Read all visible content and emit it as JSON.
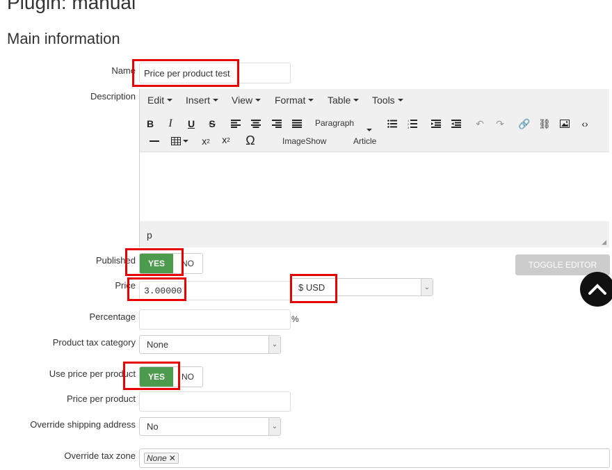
{
  "page": {
    "title": "Plugin: manual",
    "section": "Main information"
  },
  "fields": {
    "name": {
      "label": "Name",
      "value": "Price per product test"
    },
    "description": {
      "label": "Description"
    },
    "published": {
      "label": "Published",
      "yes": "YES",
      "no": "NO",
      "state": "YES"
    },
    "price": {
      "label": "Price",
      "value": "3.00000",
      "currency": "$ USD"
    },
    "percentage": {
      "label": "Percentage",
      "value": "",
      "unit": "%"
    },
    "tax_category": {
      "label": "Product tax category",
      "value": "None"
    },
    "use_price_per_product": {
      "label": "Use price per product",
      "yes": "YES",
      "no": "NO",
      "state": "YES"
    },
    "price_per_product": {
      "label": "Price per product",
      "value": ""
    },
    "override_shipping": {
      "label": "Override shipping address",
      "value": "No"
    },
    "override_tax_zone": {
      "label": "Override tax zone",
      "tag": "None",
      "remove": "✕"
    }
  },
  "editor": {
    "menus": [
      "Edit",
      "Insert",
      "View",
      "Format",
      "Table",
      "Tools"
    ],
    "paragraph": "Paragraph",
    "imageshow": "ImageShow",
    "article": "Article",
    "status_path": "p",
    "toggle_label": "TOGGLE EDITOR"
  },
  "colors": {
    "accent_green": "#4c9a4c",
    "highlight_red": "#e60000"
  }
}
